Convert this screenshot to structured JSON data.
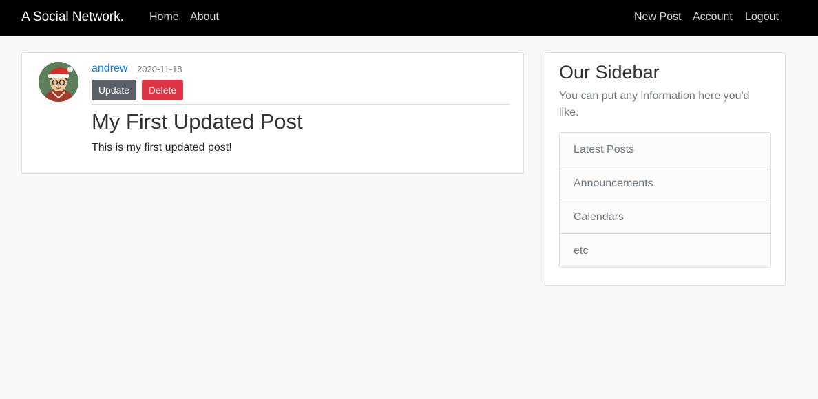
{
  "navbar": {
    "brand": "A Social Network.",
    "left_links": [
      "Home",
      "About"
    ],
    "right_links": [
      "New Post",
      "Account",
      "Logout"
    ]
  },
  "post": {
    "author": "andrew",
    "date": "2020-11-18",
    "update_label": "Update",
    "delete_label": "Delete",
    "title": "My First Updated Post",
    "content": "This is my first updated post!"
  },
  "sidebar": {
    "title": "Our Sidebar",
    "text": "You can put any information here you'd like.",
    "items": [
      "Latest Posts",
      "Announcements",
      "Calendars",
      "etc"
    ]
  },
  "colors": {
    "navbar_bg": "#000000",
    "link_blue": "#007bff",
    "update_button": "#5a6268",
    "delete_button": "#dc3545",
    "page_bg": "#f8f8f8"
  }
}
